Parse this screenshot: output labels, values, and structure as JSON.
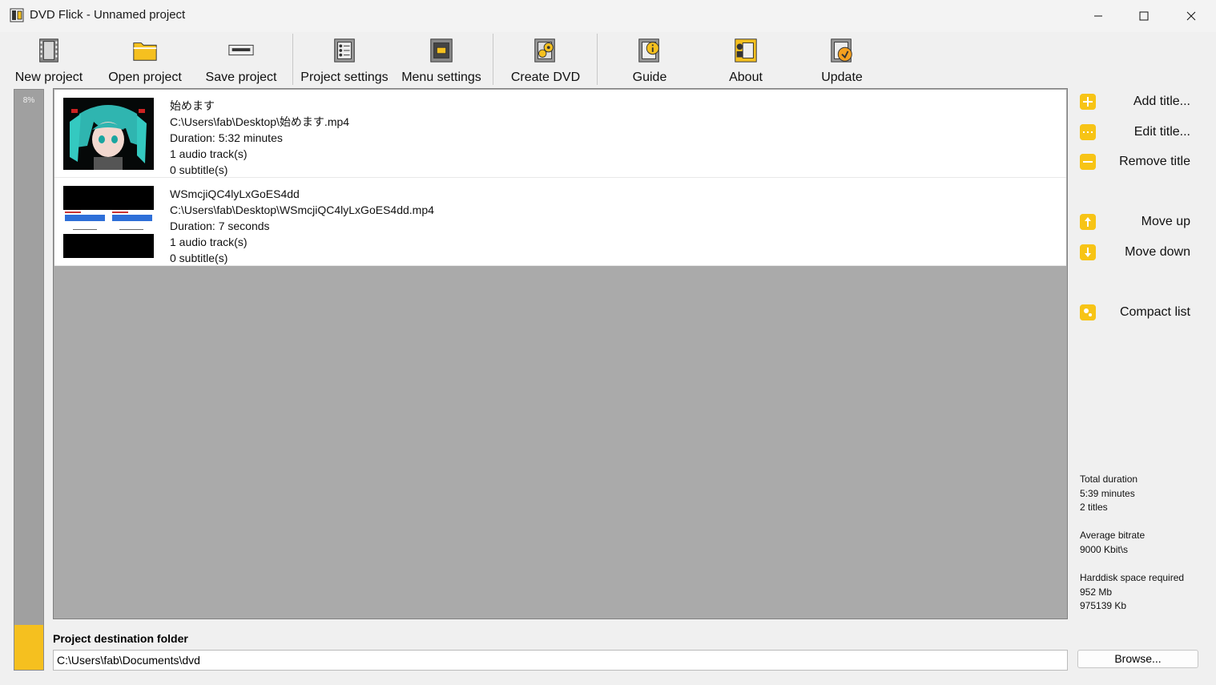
{
  "window": {
    "title": "DVD Flick - Unnamed project"
  },
  "toolbar": {
    "new_project": "New project",
    "open_project": "Open project",
    "save_project": "Save project",
    "project_settings": "Project settings",
    "menu_settings": "Menu settings",
    "create_dvd": "Create DVD",
    "guide": "Guide",
    "about": "About",
    "update": "Update"
  },
  "progress": {
    "label": "8%",
    "value": 0.08
  },
  "titles": [
    {
      "name": "始めます",
      "path": "C:\\Users\\fab\\Desktop\\始めます.mp4",
      "duration": "Duration: 5:32 minutes",
      "audio": "1 audio track(s)",
      "subtitles": "0 subtitle(s)"
    },
    {
      "name": "WSmcjiQC4lyLxGoES4dd",
      "path": "C:\\Users\\fab\\Desktop\\WSmcjiQC4lyLxGoES4dd.mp4",
      "duration": "Duration: 7 seconds",
      "audio": "1 audio track(s)",
      "subtitles": "0 subtitle(s)"
    }
  ],
  "side": {
    "add_title": "Add title...",
    "edit_title": "Edit title...",
    "remove_title": "Remove title",
    "move_up": "Move up",
    "move_down": "Move down",
    "compact_list": "Compact list"
  },
  "stats": {
    "total_duration_label": "Total duration",
    "total_duration": "5:39 minutes",
    "titles_count": "2 titles",
    "avg_bitrate_label": "Average bitrate",
    "avg_bitrate": "9000 Kbit\\s",
    "hdd_label": "Harddisk space required",
    "hdd_mb": "952 Mb",
    "hdd_kb": "975139 Kb"
  },
  "destination": {
    "label": "Project destination folder",
    "value": "C:\\Users\\fab\\Documents\\dvd",
    "browse": "Browse..."
  },
  "colors": {
    "accent": "#f5c01f",
    "list_bg": "#aaaaaa"
  }
}
